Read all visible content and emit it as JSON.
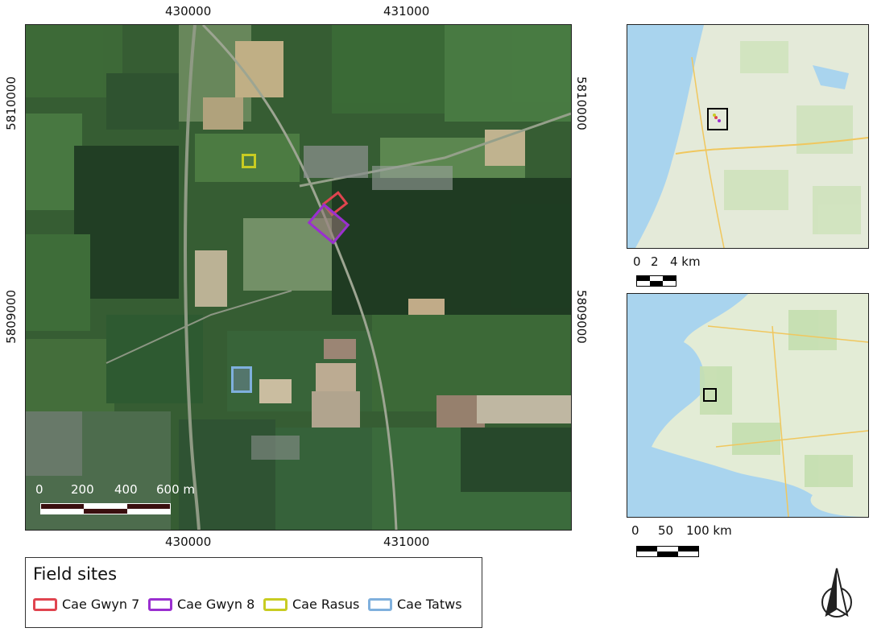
{
  "main_map": {
    "x_ticks": [
      "430000",
      "431000"
    ],
    "y_ticks": [
      "5810000",
      "5809000"
    ],
    "scalebar_labels": [
      "0",
      "200",
      "400",
      "600 m"
    ]
  },
  "inset_top": {
    "scalebar_labels": [
      "0",
      "2",
      "4 km"
    ]
  },
  "inset_bottom": {
    "scalebar_labels": [
      "0",
      "50",
      "100 km"
    ]
  },
  "legend": {
    "title": "Field sites",
    "items": [
      {
        "label": "Cae Gwyn 7",
        "color": "#e0444f"
      },
      {
        "label": "Cae Gwyn 8",
        "color": "#9a2fd0"
      },
      {
        "label": "Cae Rasus",
        "color": "#c8cc22"
      },
      {
        "label": "Cae Tatws",
        "color": "#7fb0dd"
      }
    ]
  },
  "colors": {
    "satellite_dark": "#2b4a2e",
    "satellite_field": "#3f6b3a",
    "sea": "#a9d4ee",
    "land": "#e3ecd6"
  },
  "icons": {
    "north_arrow": "north-arrow-icon"
  }
}
